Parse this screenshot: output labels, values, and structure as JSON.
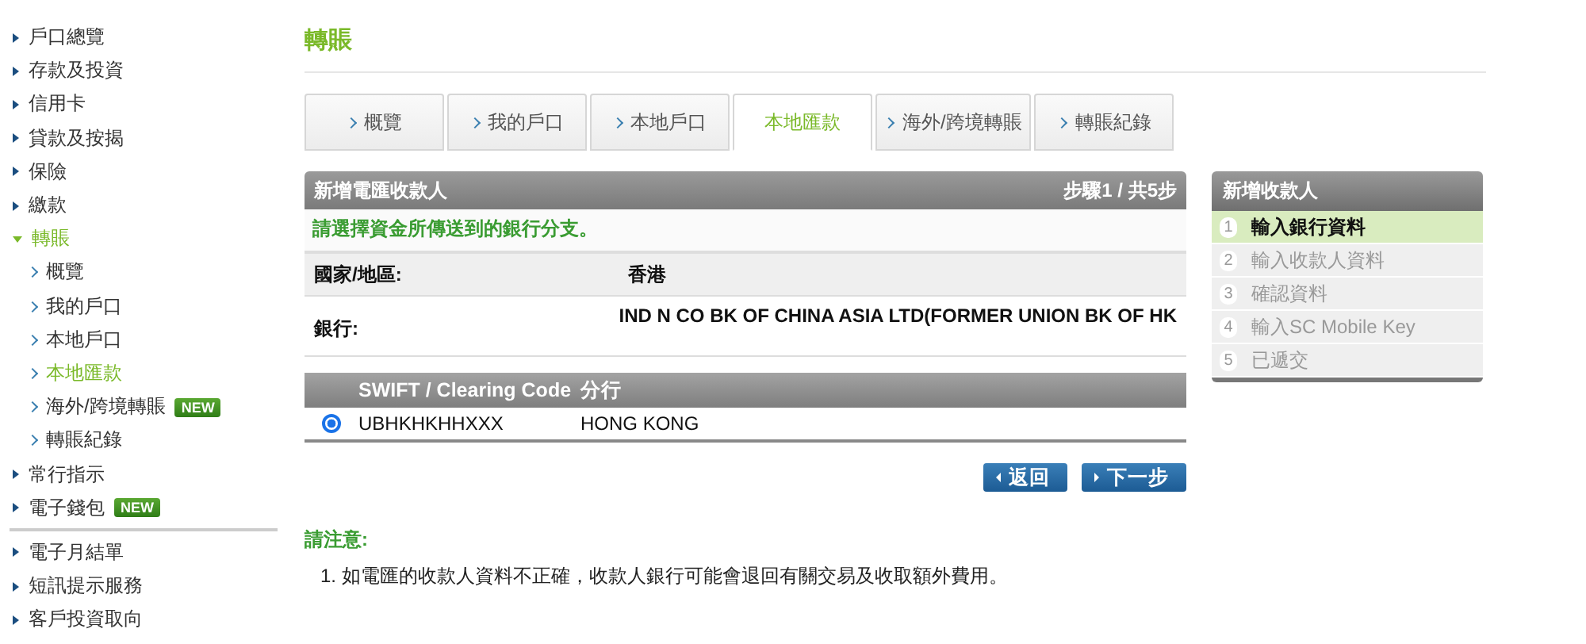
{
  "sidebar": {
    "groups": [
      [
        {
          "label": "戶口總覽",
          "expanded": false,
          "selected": false
        },
        {
          "label": "存款及投資",
          "expanded": false,
          "selected": false
        },
        {
          "label": "信用卡",
          "expanded": false,
          "selected": false
        },
        {
          "label": "貸款及按揭",
          "expanded": false,
          "selected": false
        },
        {
          "label": "保險",
          "expanded": false,
          "selected": false
        },
        {
          "label": "繳款",
          "expanded": false,
          "selected": false
        },
        {
          "label": "轉賬",
          "expanded": true,
          "selected": true,
          "children": [
            {
              "label": "概覽",
              "selected": false
            },
            {
              "label": "我的戶口",
              "selected": false
            },
            {
              "label": "本地戶口",
              "selected": false
            },
            {
              "label": "本地匯款",
              "selected": true
            },
            {
              "label": "海外/跨境轉賬",
              "selected": false,
              "badge": "NEW"
            },
            {
              "label": "轉賬紀錄",
              "selected": false
            }
          ]
        },
        {
          "label": "常行指示",
          "expanded": false,
          "selected": false
        },
        {
          "label": "電子錢包",
          "expanded": false,
          "selected": false,
          "badge": "NEW"
        }
      ],
      [
        {
          "label": "電子月結單",
          "expanded": false,
          "selected": false
        },
        {
          "label": "短訊提示服務",
          "expanded": false,
          "selected": false
        },
        {
          "label": "客戶投資取向",
          "expanded": false,
          "selected": false
        }
      ]
    ]
  },
  "page_title": "轉賬",
  "tabs": [
    {
      "label": "概覽",
      "selected": false
    },
    {
      "label": "我的戶口",
      "selected": false
    },
    {
      "label": "本地戶口",
      "selected": false
    },
    {
      "label": "本地匯款",
      "selected": true
    },
    {
      "label": "海外/跨境轉賬",
      "selected": false
    },
    {
      "label": "轉賬紀錄",
      "selected": false
    }
  ],
  "form": {
    "title": "新增電匯收款人",
    "step": "步驟1 / 共5步",
    "instruction": "請選擇資金所傳送到的銀行分支。",
    "fields": [
      {
        "label": "國家/地區:",
        "value": "香港"
      },
      {
        "label": "銀行:",
        "value": "IND N CO BK OF CHINA ASIA LTD(FORMER UNION BK OF HK"
      }
    ],
    "table": {
      "columns": [
        "SWIFT / Clearing Code",
        "分行"
      ],
      "rows": [
        {
          "code": "UBHKHKHHXXX",
          "branch": "HONG KONG",
          "selected": true
        }
      ]
    },
    "buttons": [
      {
        "label": "返回",
        "kind": "back"
      },
      {
        "label": "下一步",
        "kind": "next"
      }
    ]
  },
  "steps_panel": {
    "title": "新增收款人",
    "steps": [
      {
        "number": "1",
        "label": "輸入銀行資料",
        "selected": true
      },
      {
        "number": "2",
        "label": "輸入收款人資料",
        "selected": false
      },
      {
        "number": "3",
        "label": "確認資料",
        "selected": false
      },
      {
        "number": "4",
        "label": "輸入SC Mobile Key",
        "selected": false
      },
      {
        "number": "5",
        "label": "已遞交",
        "selected": false
      }
    ]
  },
  "notes": {
    "title": "請注意:",
    "items": [
      "1. 如電匯的收款人資料不正確，收款人銀行可能會退回有關交易及收取額外費用。"
    ]
  }
}
